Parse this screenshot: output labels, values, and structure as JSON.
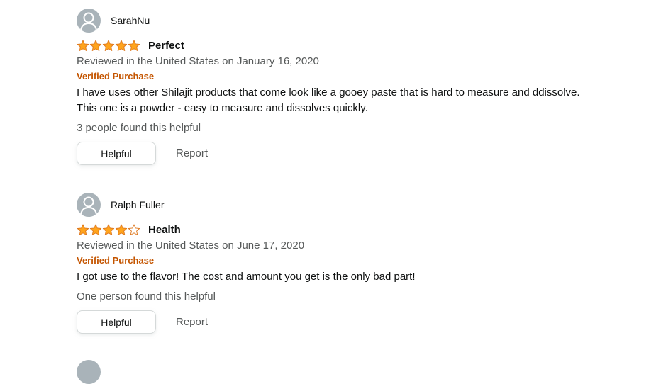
{
  "colors": {
    "star_fill": "#ffa41c",
    "star_stroke": "#de7921",
    "verified": "#c45500",
    "secondary_text": "#565959",
    "avatar_bg": "#a9b3b9"
  },
  "reviews": [
    {
      "profile_name": "SarahNu",
      "rating": 5,
      "title": "Perfect",
      "date": "Reviewed in the United States on January 16, 2020",
      "verified": "Verified Purchase",
      "body_lines": [
        "I have uses other Shilajit products that come look like a gooey paste that is hard to measure and ddissolve.",
        "This one is a powder - easy to measure and dissolves quickly."
      ],
      "helpful_count": "3 people found this helpful",
      "helpful_button": "Helpful",
      "report_link": "Report"
    },
    {
      "profile_name": "Ralph Fuller",
      "rating": 4,
      "title": "Health",
      "date": "Reviewed in the United States on June 17, 2020",
      "verified": "Verified Purchase",
      "body_lines": [
        "I got use to the flavor! The cost and amount you get is the only bad part!"
      ],
      "helpful_count": "One person found this helpful",
      "helpful_button": "Helpful",
      "report_link": "Report"
    }
  ]
}
